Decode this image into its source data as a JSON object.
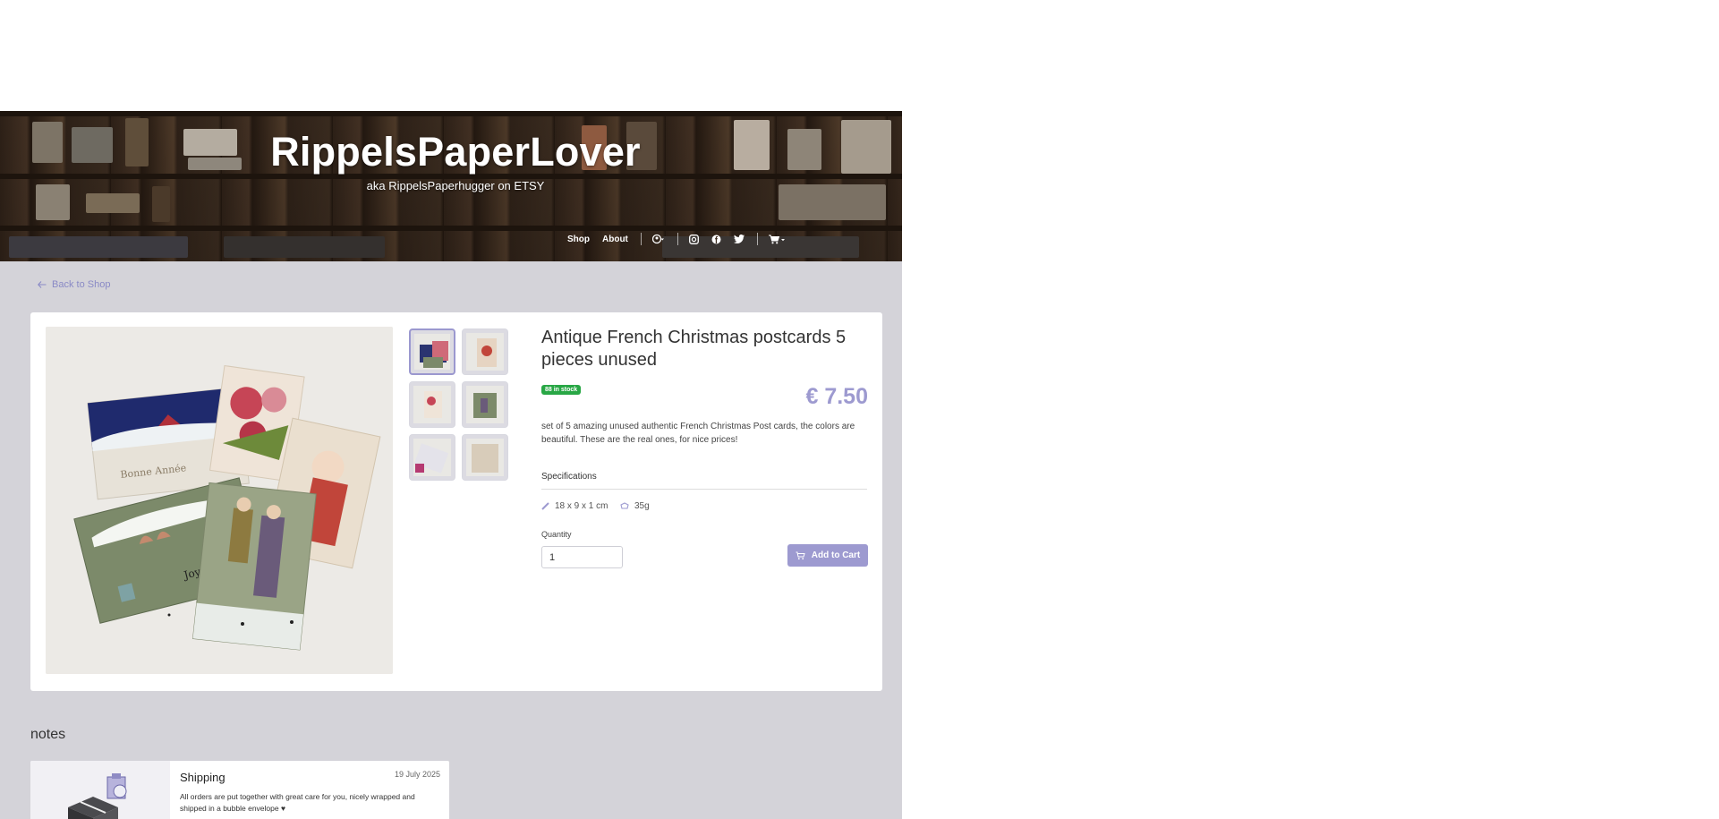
{
  "header": {
    "title": "RippelsPaperLover",
    "subtitle": "aka RippelsPaperhugger on ETSY"
  },
  "nav": {
    "items": [
      {
        "label": "Shop"
      },
      {
        "label": "About"
      }
    ],
    "icons": [
      "user-circle-icon",
      "instagram-icon",
      "facebook-icon",
      "twitter-icon",
      "shopping-cart-icon"
    ]
  },
  "back_link": {
    "label": "Back to Shop"
  },
  "product": {
    "title": "Antique French Christmas postcards 5 pieces unused",
    "stock": "88 in stock",
    "price": "€ 7.50",
    "description": "set of 5 amazing unused authentic French Christmas Post cards, the colors are beautiful. These are the real ones, for nice prices!",
    "specs_heading": "Specifications",
    "dimensions": "18 x 9 x 1 cm",
    "weight": "35g",
    "quantity_label": "Quantity",
    "quantity_value": "1",
    "add_to_cart": "Add to Cart",
    "image_count": 6
  },
  "notes": {
    "heading": "notes",
    "items": [
      {
        "title": "Shipping",
        "date": "19 July 2025",
        "body": "All orders are put together with great care for you, nicely wrapped and shipped in a bubble envelope ♥"
      }
    ]
  },
  "colors": {
    "accent": "#9d9ad0",
    "stock_badge": "#28a745",
    "main_bg": "#d4d3d9"
  }
}
